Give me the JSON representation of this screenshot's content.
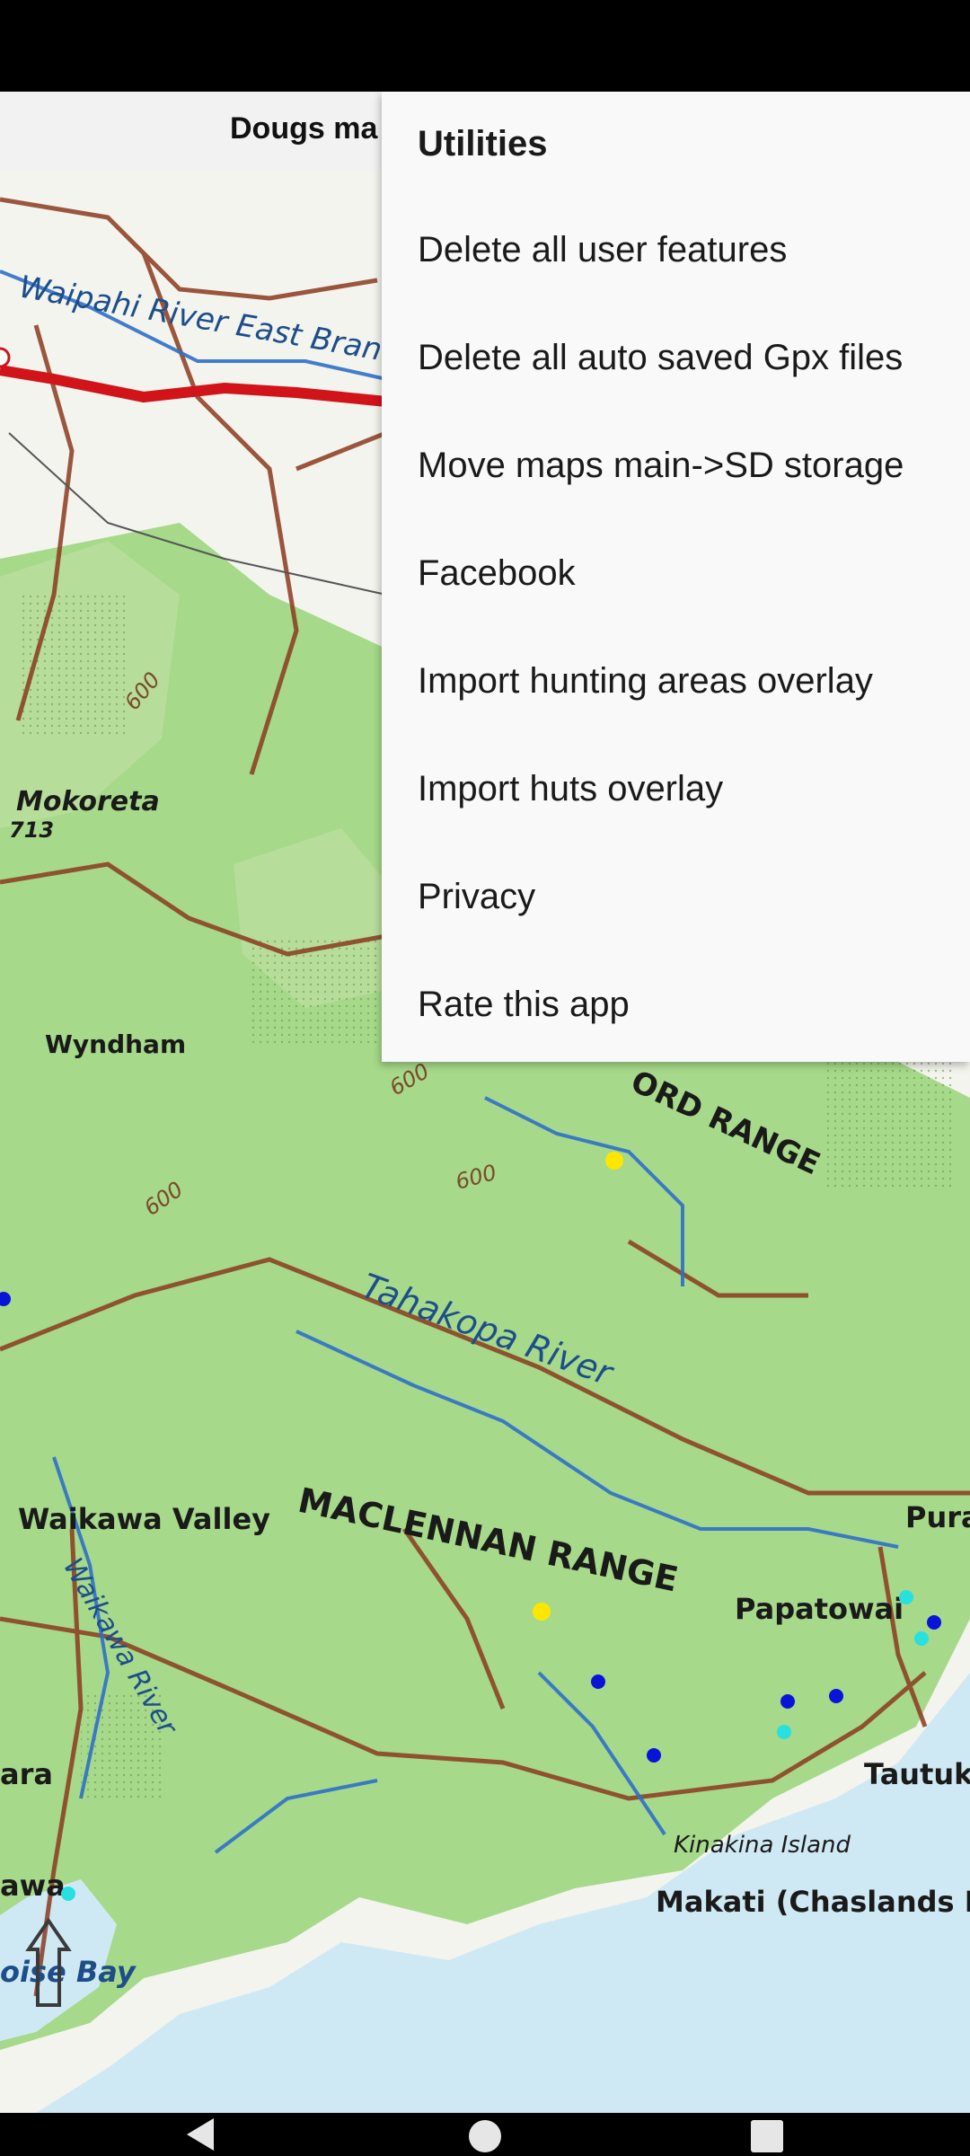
{
  "app_bar": {
    "title": "Dougs ma"
  },
  "menu": {
    "title": "Utilities",
    "items": [
      {
        "label": "Delete all user features"
      },
      {
        "label": "Delete all auto saved Gpx files"
      },
      {
        "label": "Move maps main->SD storage"
      },
      {
        "label": "Facebook"
      },
      {
        "label": "Import hunting areas overlay"
      },
      {
        "label": "Import huts overlay"
      },
      {
        "label": "Privacy"
      },
      {
        "label": "Rate this app"
      }
    ]
  },
  "map": {
    "labels": {
      "waipahi": "Waipahi River East Branc",
      "mokoreta": "Mokoreta",
      "mokoreta_height": "713",
      "contour_600_a": "600",
      "contour_600_b": "600",
      "contour_600_c": "600",
      "contour_600_d": "600",
      "wyndham": "Wyndham",
      "ford_range": "ORD RANGE",
      "tahakopa": "Tahakopa River",
      "maclennan": "MACLENNAN RANGE",
      "waikawa_valley": "Waikawa Valley",
      "waikawa_river": "Waikawa River",
      "papatowai": "Papatowai",
      "pura": "Pura",
      "tautuku": "Tautuk",
      "kinakina": "Kinakina Island",
      "makati": "Makati (Chaslands M",
      "ara": "ara",
      "awa": "awa",
      "bay": "oise Bay"
    },
    "colors": {
      "land": "#a6d98a",
      "sea": "#cfe9f4",
      "road": "#8b3a1e",
      "highway": "#d0141a",
      "river": "#2f6fc9",
      "hut_marker": "#ffe600",
      "waypoint_blue": "#0a14d8",
      "waypoint_cyan": "#28e0e0"
    }
  },
  "nav_bar": {
    "back_icon": "back-triangle-icon",
    "home_icon": "home-circle-icon",
    "recents_icon": "recents-square-icon"
  }
}
